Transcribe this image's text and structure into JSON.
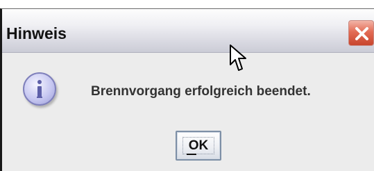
{
  "dialog": {
    "title": "Hinweis",
    "message": "Brennvorgang erfolgreich beendet.",
    "ok_label": "OK",
    "icons": {
      "info": "info-icon",
      "close": "close-icon",
      "cursor": "mouse-pointer-icon"
    }
  },
  "colors": {
    "close_accent": "#d65a42",
    "info_icon": "#b9bbed",
    "dialog_bg": "#ececec"
  }
}
